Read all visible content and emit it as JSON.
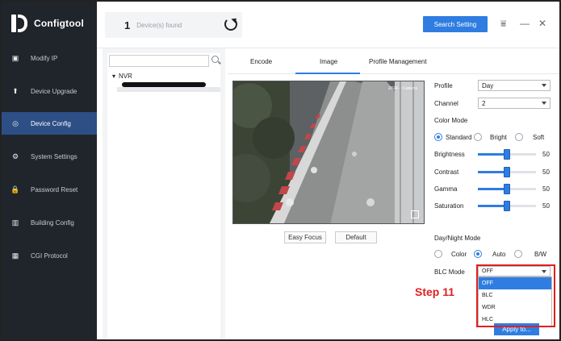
{
  "app": {
    "title": "Configtool"
  },
  "sidebar": {
    "items": [
      {
        "label": "Modify IP",
        "icon": "modify-ip-icon",
        "glyph": "▣"
      },
      {
        "label": "Device Upgrade",
        "icon": "upgrade-icon",
        "glyph": "⬆"
      },
      {
        "label": "Device Config",
        "icon": "config-icon",
        "glyph": "◎",
        "active": true
      },
      {
        "label": "System Settings",
        "icon": "system-settings-icon",
        "glyph": "⚙"
      },
      {
        "label": "Password Reset",
        "icon": "lock-icon",
        "glyph": "🔒"
      },
      {
        "label": "Building Config",
        "icon": "building-icon",
        "glyph": "▥"
      },
      {
        "label": "CGI Protocol",
        "icon": "grid-icon",
        "glyph": "▦"
      }
    ]
  },
  "topbar": {
    "device_count": "1",
    "device_label": "Device(s) found",
    "search_setting": "Search Setting",
    "filter_glyph": "⩸",
    "minimize_glyph": "—",
    "close_glyph": "✕"
  },
  "tree": {
    "root_label": "NVR",
    "expand_glyph": "▾"
  },
  "tabs": [
    "Encode",
    "Image",
    "Profile Management"
  ],
  "preview": {
    "easy_focus": "Easy Focus",
    "default": "Default",
    "stamp": "2024-·Camera"
  },
  "image_settings": {
    "profile_label": "Profile",
    "profile_value": "Day",
    "channel_label": "Channel",
    "channel_value": "2",
    "color_mode_label": "Color Mode",
    "color_modes": [
      "Standard",
      "Bright",
      "Soft"
    ],
    "color_mode_selected": "Standard",
    "sliders": [
      {
        "label": "Brightness",
        "value": 50
      },
      {
        "label": "Contrast",
        "value": 50
      },
      {
        "label": "Gamma",
        "value": 50
      },
      {
        "label": "Saturation",
        "value": 50
      }
    ],
    "daynight_label": "Day/Night Mode",
    "daynight_modes": [
      "Color",
      "Auto",
      "B/W"
    ],
    "daynight_selected": "Auto",
    "blc_label": "BLC Mode",
    "blc_value": "OFF",
    "blc_options": [
      "OFF",
      "BLC",
      "WDR",
      "HLC"
    ],
    "apply_label": "Apply to..."
  },
  "annotation": {
    "step_text": "Step 11"
  },
  "colors": {
    "accent": "#2f7de1",
    "sidebar_bg": "#20242b",
    "highlight_red": "#e02020"
  }
}
